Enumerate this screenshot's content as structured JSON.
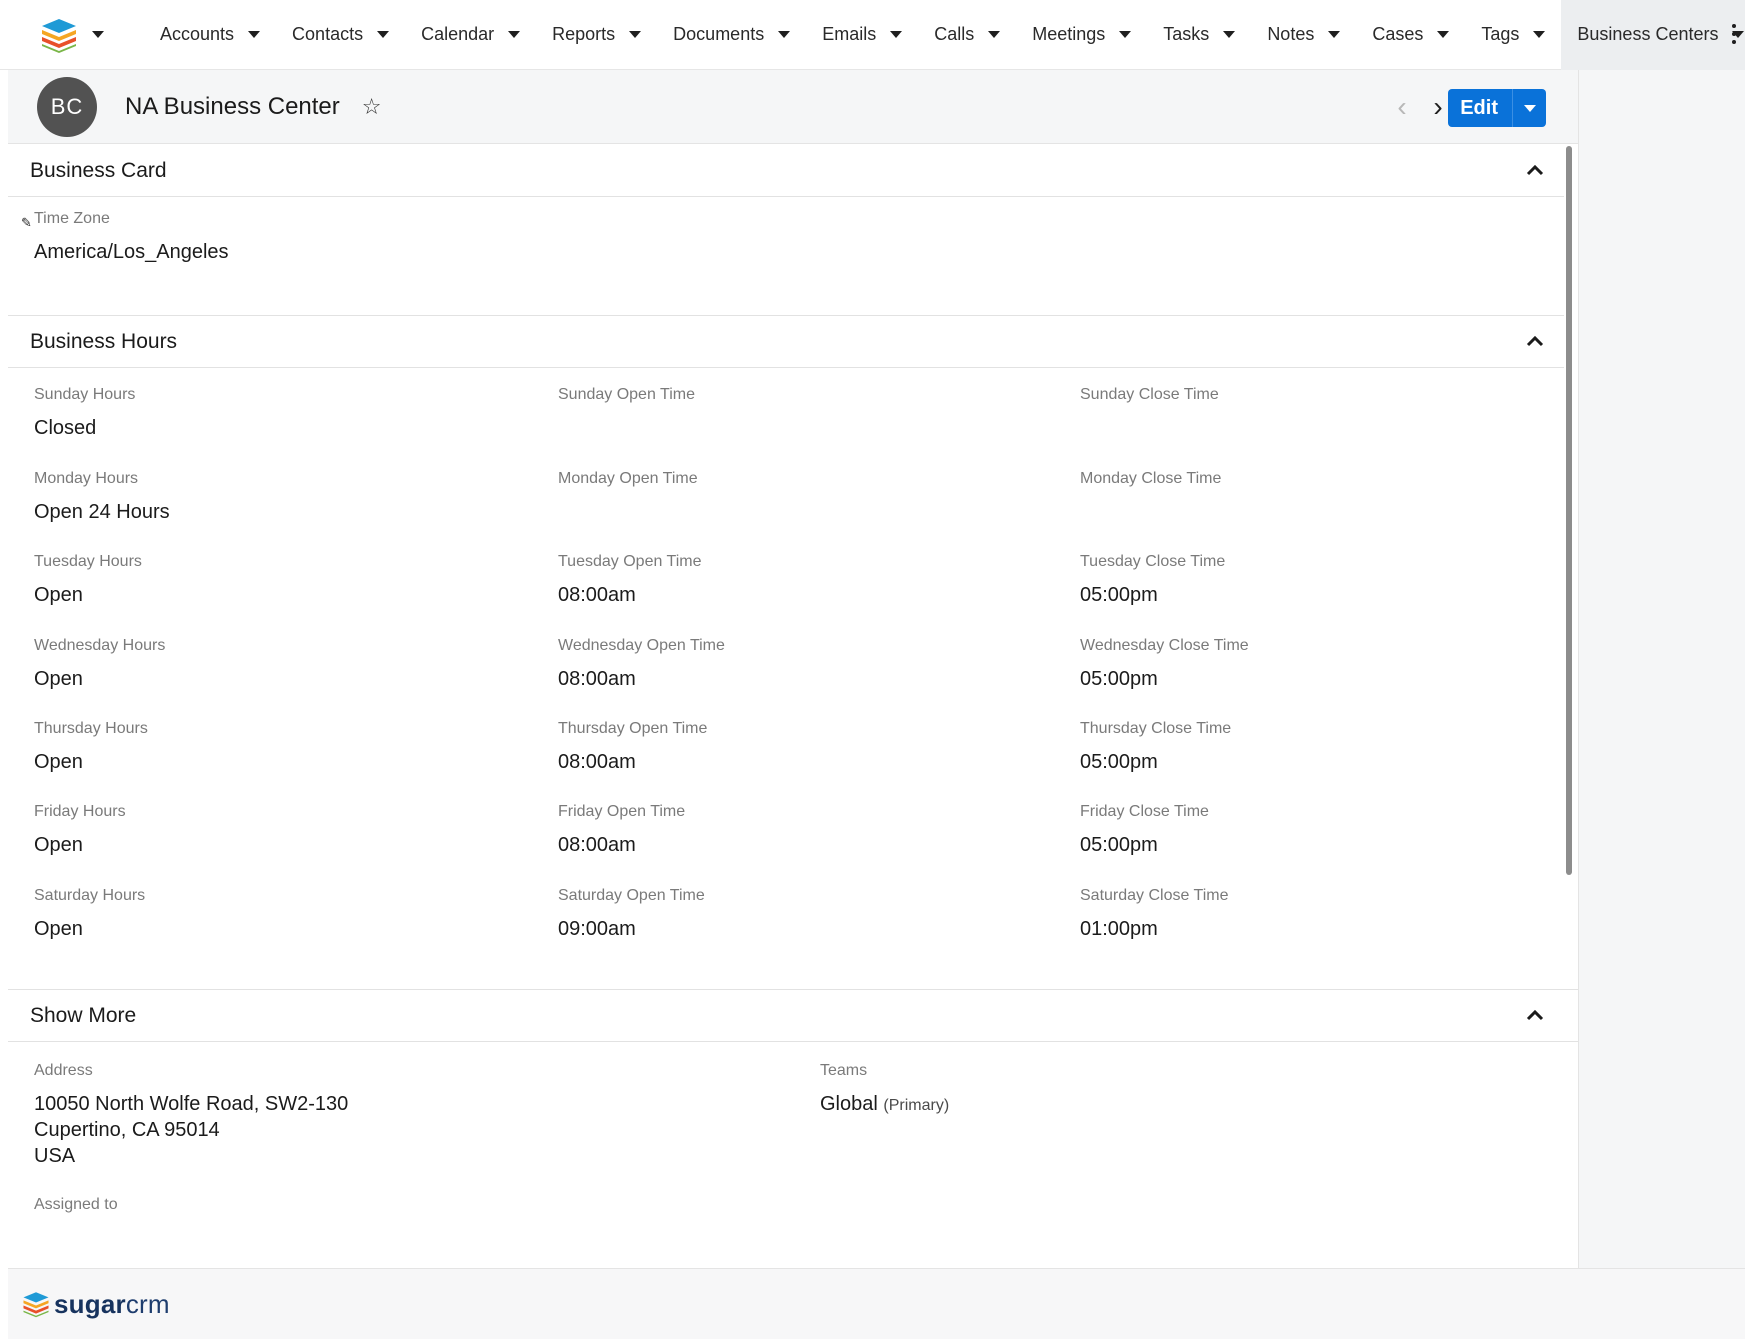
{
  "nav": {
    "items": [
      {
        "label": "Accounts"
      },
      {
        "label": "Contacts"
      },
      {
        "label": "Calendar"
      },
      {
        "label": "Reports"
      },
      {
        "label": "Documents"
      },
      {
        "label": "Emails"
      },
      {
        "label": "Calls"
      },
      {
        "label": "Meetings"
      },
      {
        "label": "Tasks"
      },
      {
        "label": "Notes"
      },
      {
        "label": "Cases"
      },
      {
        "label": "Tags"
      }
    ],
    "active_label": "Business Centers"
  },
  "record": {
    "avatar_initials": "BC",
    "title": "NA Business Center",
    "edit_label": "Edit",
    "next_symbol": "›",
    "prev_symbol": "‹",
    "collapse_symbol": "»",
    "fav_symbol": "☆"
  },
  "business_card": {
    "title": "Business Card",
    "time_zone_label": "Time Zone",
    "time_zone_value": "America/Los_Angeles"
  },
  "business_hours": {
    "title": "Business Hours",
    "days": [
      {
        "hours_label": "Sunday Hours",
        "hours": "Closed",
        "open_label": "Sunday Open Time",
        "open": "",
        "close_label": "Sunday Close Time",
        "close": ""
      },
      {
        "hours_label": "Monday Hours",
        "hours": "Open 24 Hours",
        "open_label": "Monday Open Time",
        "open": "",
        "close_label": "Monday Close Time",
        "close": ""
      },
      {
        "hours_label": "Tuesday Hours",
        "hours": "Open",
        "open_label": "Tuesday Open Time",
        "open": "08:00am",
        "close_label": "Tuesday Close Time",
        "close": "05:00pm"
      },
      {
        "hours_label": "Wednesday Hours",
        "hours": "Open",
        "open_label": "Wednesday Open Time",
        "open": "08:00am",
        "close_label": "Wednesday Close Time",
        "close": "05:00pm"
      },
      {
        "hours_label": "Thursday Hours",
        "hours": "Open",
        "open_label": "Thursday Open Time",
        "open": "08:00am",
        "close_label": "Thursday Close Time",
        "close": "05:00pm"
      },
      {
        "hours_label": "Friday Hours",
        "hours": "Open",
        "open_label": "Friday Open Time",
        "open": "08:00am",
        "close_label": "Friday Close Time",
        "close": "05:00pm"
      },
      {
        "hours_label": "Saturday Hours",
        "hours": "Open",
        "open_label": "Saturday Open Time",
        "open": "09:00am",
        "close_label": "Saturday Close Time",
        "close": "01:00pm"
      }
    ]
  },
  "show_more": {
    "title": "Show More",
    "address_label": "Address",
    "address_line1": "10050 North Wolfe Road, SW2-130",
    "address_line2": "Cupertino, CA 95014",
    "address_line3": "USA",
    "teams_label": "Teams",
    "teams_value": "Global",
    "teams_note": "(Primary)",
    "assigned_label": "Assigned to"
  },
  "footer": {
    "brand_bold": "sugar",
    "brand_rest": "crm"
  },
  "colors": {
    "primary_button": "#0a72d9",
    "avatar": "#525252",
    "header_bg": "#f5f6f7"
  }
}
